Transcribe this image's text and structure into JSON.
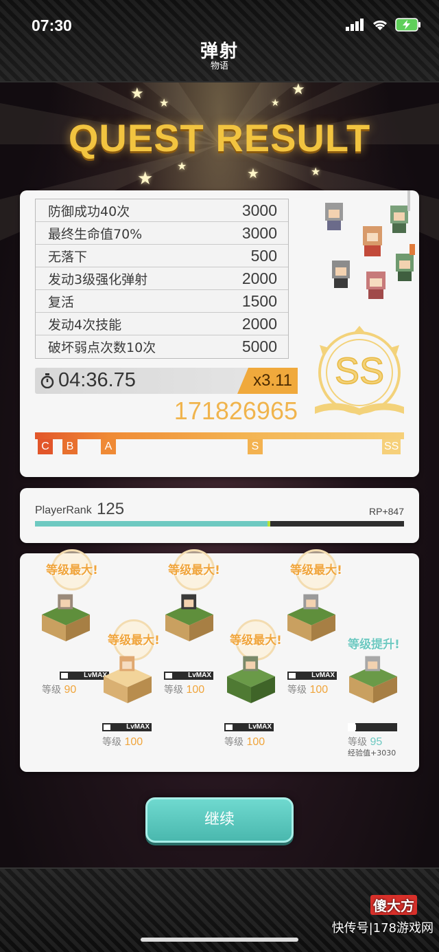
{
  "status": {
    "time": "07:30"
  },
  "logo": {
    "big": "弹射",
    "small": "物语"
  },
  "title": "QUEST RESULT",
  "bonuses": [
    {
      "label": "防御成功40次",
      "points": "3000"
    },
    {
      "label": "最终生命值70%",
      "points": "3000"
    },
    {
      "label": "无落下",
      "points": "500"
    },
    {
      "label": "发动3级强化弹射",
      "points": "2000"
    },
    {
      "label": "复活",
      "points": "1500"
    },
    {
      "label": "发动4次技能",
      "points": "2000"
    },
    {
      "label": "破坏弱点次数10次",
      "points": "5000"
    }
  ],
  "clear_time": "04:36.75",
  "multiplier": "x3.11",
  "score": "171826965",
  "rank_grade": "SS",
  "rank_markers": [
    "C",
    "B",
    "A",
    "S",
    "SS"
  ],
  "rank_progress": 1.0,
  "player": {
    "rank_label": "PlayerRank",
    "rank_value": "125",
    "rp": "RP+847",
    "progress": 0.63
  },
  "units": [
    {
      "badge": "等级最大!",
      "lvbar": "LvMAX",
      "level_label": "等级",
      "level": "90"
    },
    {
      "badge": "等级最大!",
      "lvbar": "LvMAX",
      "level_label": "等级",
      "level": "100"
    },
    {
      "badge": "等级最大!",
      "lvbar": "LvMAX",
      "level_label": "等级",
      "level": "100"
    },
    {
      "badge": "等级最大!",
      "lvbar": "LvMAX",
      "level_label": "等级",
      "level": "100"
    },
    {
      "badge": "等级最大!",
      "lvbar": "LvMAX",
      "level_label": "等级",
      "level": "100"
    },
    {
      "badge": "等级提升!",
      "lvbar": "",
      "level_label": "等级",
      "level": "95",
      "exp": "经验值+3030",
      "exp_progress": 0.15
    }
  ],
  "continue_label": "继续",
  "watermark": {
    "logo": "傻大方",
    "text": "快传号|178游戏网"
  },
  "colors": {
    "accent_gold": "#f2c440",
    "teal": "#6ec9c1",
    "orange": "#f0a53c"
  }
}
